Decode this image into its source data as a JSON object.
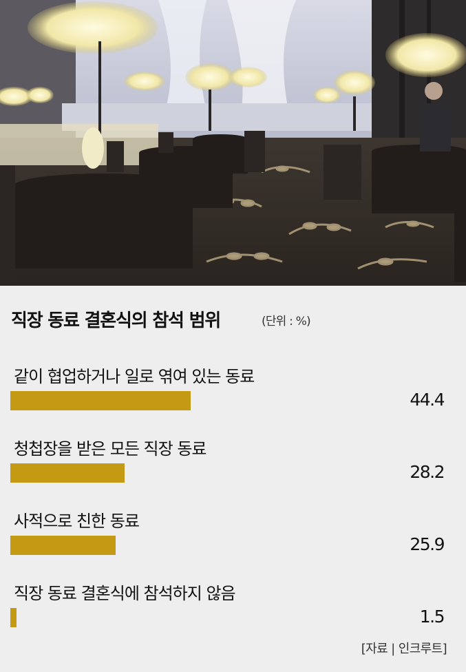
{
  "chart_data": {
    "type": "bar",
    "orientation": "horizontal",
    "title": "직장 동료 결혼식의 참석 범위",
    "unit_note": "(단위 : %)",
    "categories": [
      "같이 협업하거나 일로 엮여 있는 동료",
      "청첩장을 받은 모든 직장 동료",
      "사적으로 친한 동료",
      "직장 동료 결혼식에 참석하지 않음"
    ],
    "values": [
      44.4,
      28.2,
      25.9,
      1.5
    ],
    "value_labels": [
      "44.4",
      "28.2",
      "25.9",
      "1.5"
    ],
    "bar_color": "#c49a14",
    "source": "[자료 | 인크루트]"
  },
  "photo": {
    "description_icon": "wedding-hall-photo"
  }
}
